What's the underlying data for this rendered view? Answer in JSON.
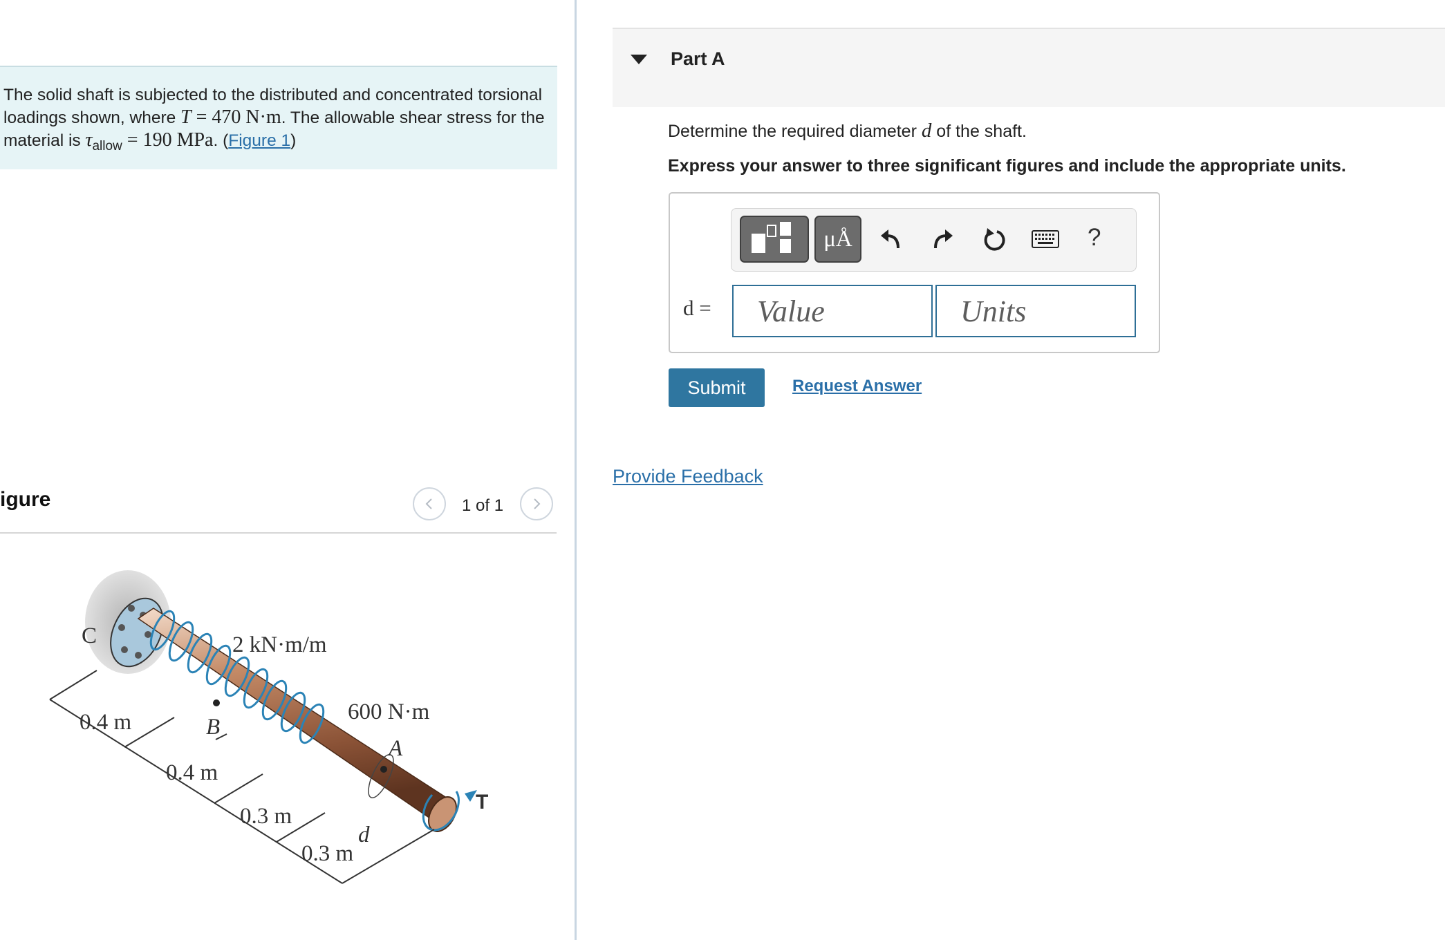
{
  "problem": {
    "text_before": "The solid shaft is subjected to the distributed and concentrated torsional loadings shown, where ",
    "T_symbol": "T",
    "T_value": " = 470 N·m",
    "text_mid": ". The allowable shear stress for the material is ",
    "tau_symbol": "τ",
    "tau_sub": "allow",
    "tau_value": " = 190 MPa",
    "text_after": ". (",
    "figure_link": "Figure 1",
    "close_paren": ")"
  },
  "figure": {
    "title": "igure",
    "counter": "1 of 1",
    "labels": {
      "C": "C",
      "B": "B",
      "A": "A",
      "d": "d",
      "T": "T",
      "dist_load": "2 kN·m/m",
      "conc_load": "600 N·m",
      "seg1": "0.4 m",
      "seg2": "0.4 m",
      "seg3": "0.3 m",
      "seg4": "0.3 m"
    }
  },
  "part": {
    "title": "Part A",
    "question_before": "Determine the required diameter ",
    "question_var": "d",
    "question_after": " of the shaft.",
    "instruction": "Express your answer to three significant figures and include the appropriate units.",
    "toolbar": {
      "units_btn": "μÅ",
      "help": "?"
    },
    "eq_label": "d =",
    "value_placeholder": "Value",
    "units_placeholder": "Units",
    "submit": "Submit",
    "request_answer": "Request Answer"
  },
  "feedback": "Provide Feedback",
  "colors": {
    "accent": "#2f76a0",
    "link": "#2a6fa8",
    "problem_bg": "#e6f4f6"
  }
}
